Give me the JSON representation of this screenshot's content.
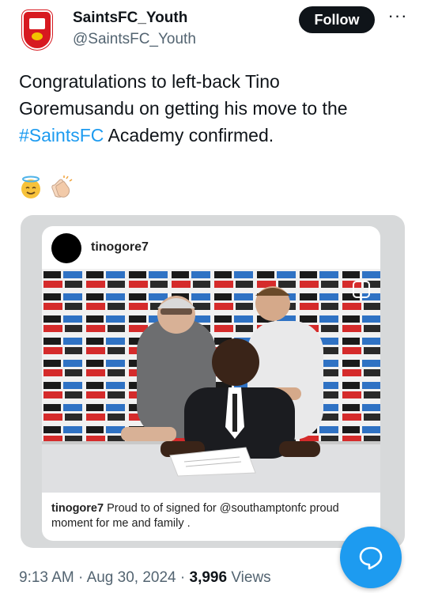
{
  "account": {
    "name": "SaintsFC_Youth",
    "handle": "@SaintsFC_Youth",
    "follow_label": "Follow",
    "more_label": "···"
  },
  "tweet": {
    "text_before": "Congratulations to left-back Tino Goremusandu on getting his move to the ",
    "hashtag": "#SaintsFC",
    "text_after": " Academy confirmed.",
    "emojis": [
      "smiling-face-with-halo",
      "clapping-hands"
    ]
  },
  "instagram_card": {
    "username": "tinogore7",
    "caption_user": "tinogore7",
    "caption_text": "Proud to of signed for @southamptonfc proud moment for me and family ."
  },
  "meta": {
    "time": "9:13 AM",
    "separator": "·",
    "date": "Aug 30, 2024",
    "views_count": "3,996",
    "views_label": "Views"
  },
  "colors": {
    "accent": "#1d9bf0",
    "text": "#0f1419",
    "muted": "#536471",
    "brand": "#d71920"
  },
  "icons": {
    "reply_fab": "reply-bubble-icon"
  }
}
